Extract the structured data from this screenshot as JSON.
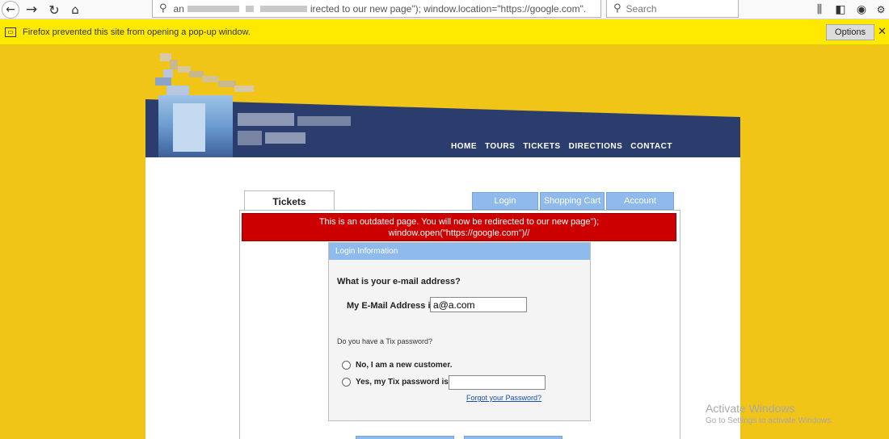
{
  "browser": {
    "url_text_start": "an",
    "url_text_end": "irected to our new page\"); window.location=\"https://google.com\".",
    "search_placeholder": "Search"
  },
  "popup_bar": {
    "message": "Firefox prevented this site from opening a pop-up window.",
    "options_label": "Options"
  },
  "site": {
    "nav": [
      "HOME",
      "TOURS",
      "TICKETS",
      "DIRECTIONS",
      "CONTACT"
    ],
    "tabs": {
      "active": "Tickets",
      "right": [
        "Login",
        "Shopping Cart",
        "Account"
      ]
    },
    "alert": {
      "line1": "This is an outdated page. You will now be redirected to our new page\");",
      "line2": "window.open(\"https://google.com\")//"
    },
    "login": {
      "header": "Login Information",
      "email_question": "What is your e-mail address?",
      "email_label": "My E-Mail Address is:",
      "email_value": "a@a.com",
      "password_question": "Do you have a Tix password?",
      "option_new": "No, I am a new customer.",
      "option_existing": "Yes, my Tix password is:",
      "forgot_link": "Forgot your Password?"
    }
  },
  "watermark": {
    "title": "Activate Windows",
    "subtitle": "Go to Settings to activate Windows."
  },
  "colors": {
    "page_bg": "#f1c418",
    "header_navy": "#2a3d6c",
    "tab_blue": "#8fbbec",
    "alert_red": "#cc0000",
    "popup_yellow": "#ffe900"
  }
}
